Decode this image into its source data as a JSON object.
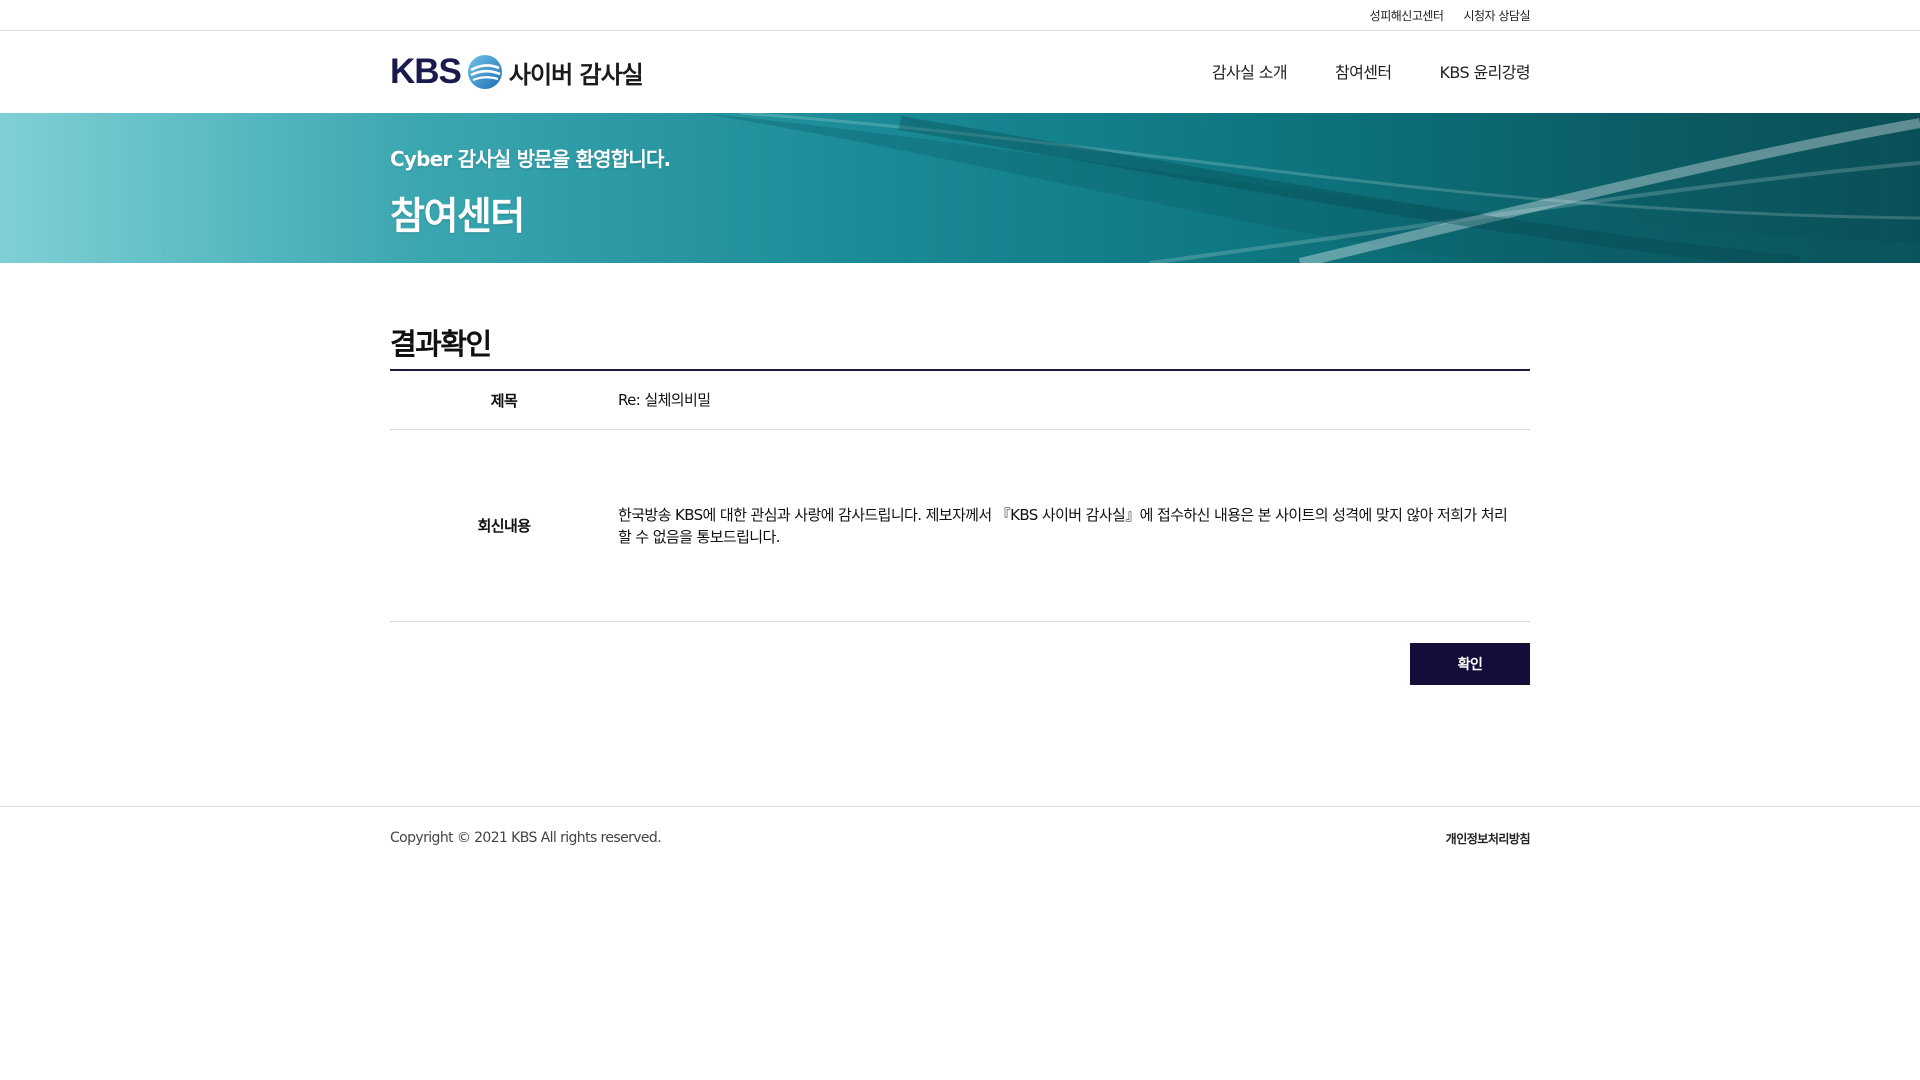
{
  "util_links": [
    {
      "label": "성피해신고센터"
    },
    {
      "label": "시청자 상담실"
    }
  ],
  "header": {
    "logo_kbs": "KBS",
    "logo_text": "사이버 감사실",
    "nav": [
      {
        "label": "감사실 소개"
      },
      {
        "label": "참여센터"
      },
      {
        "label": "KBS 윤리강령"
      }
    ]
  },
  "banner": {
    "subtitle": "Cyber 감사실 방문을 환영합니다.",
    "title": "참여센터"
  },
  "main": {
    "section_title": "결과확인",
    "subject_label": "제목",
    "subject_value": "Re: 실체의비밀",
    "reply_label": "회신내용",
    "reply_value": "한국방송 KBS에 대한 관심과 사랑에 감사드립니다. 제보자께서 『KBS 사이버 감사실』에 접수하신 내용은 본 사이트의 성격에 맞지 않아 저희가 처리할 수 없음을 통보드립니다.",
    "confirm_label": "확인"
  },
  "footer": {
    "copyright": "Copyright © 2021 KBS All rights reserved.",
    "privacy": "개인정보처리방침"
  },
  "colors": {
    "brand_navy": "#1b1a4e",
    "button_bg": "#130d3a",
    "banner_teal": "#1a8b97"
  }
}
